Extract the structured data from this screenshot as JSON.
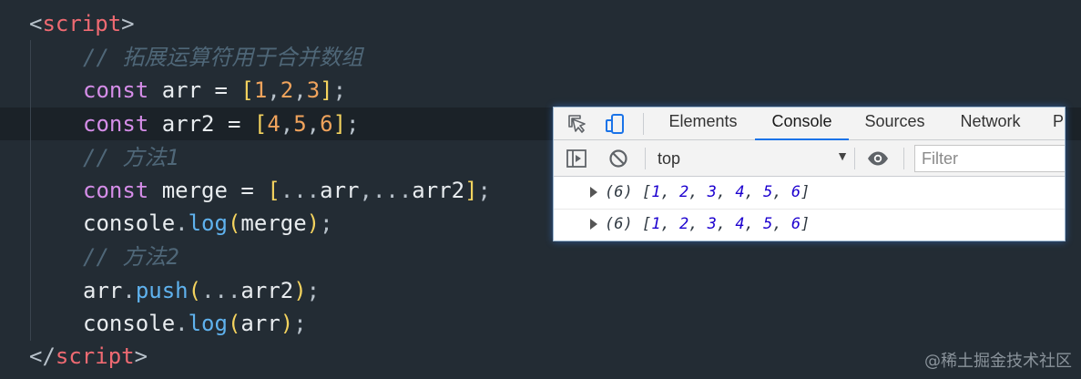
{
  "editor": {
    "open_tag": {
      "lt": "<",
      "name": "script",
      "gt": ">"
    },
    "close_tag": {
      "lt": "</",
      "name": "script",
      "gt": ">"
    },
    "comment_merge": "// 拓展运算符用于合并数组",
    "comment_method1": "// 方法1",
    "comment_method2": "// 方法2",
    "kw_const": "const",
    "var_arr": "arr",
    "var_arr2": "arr2",
    "var_merge": "merge",
    "op_assign": "=",
    "arr1_values": [
      "1",
      "2",
      "3"
    ],
    "arr2_values": [
      "4",
      "5",
      "6"
    ],
    "spread": "...",
    "console_obj": "console",
    "fn_log": "log",
    "fn_push": "push"
  },
  "devtools": {
    "tabs": [
      "Elements",
      "Console",
      "Sources",
      "Network",
      "P"
    ],
    "active_tab": "Console",
    "context": "top",
    "filter_placeholder": "Filter",
    "logs": [
      {
        "count": "(6)",
        "values": [
          "1",
          "2",
          "3",
          "4",
          "5",
          "6"
        ]
      },
      {
        "count": "(6)",
        "values": [
          "1",
          "2",
          "3",
          "4",
          "5",
          "6"
        ]
      }
    ]
  },
  "watermark": "@稀土掘金技术社区",
  "colors": {
    "editor_bg": "#232c34",
    "keyword": "#d58de8",
    "tag": "#ef6a72",
    "number": "#f0a35c",
    "bracket": "#f4d35e",
    "function": "#5fb2ee",
    "comment": "#4f6778",
    "devtools_accent": "#1a73e8"
  }
}
